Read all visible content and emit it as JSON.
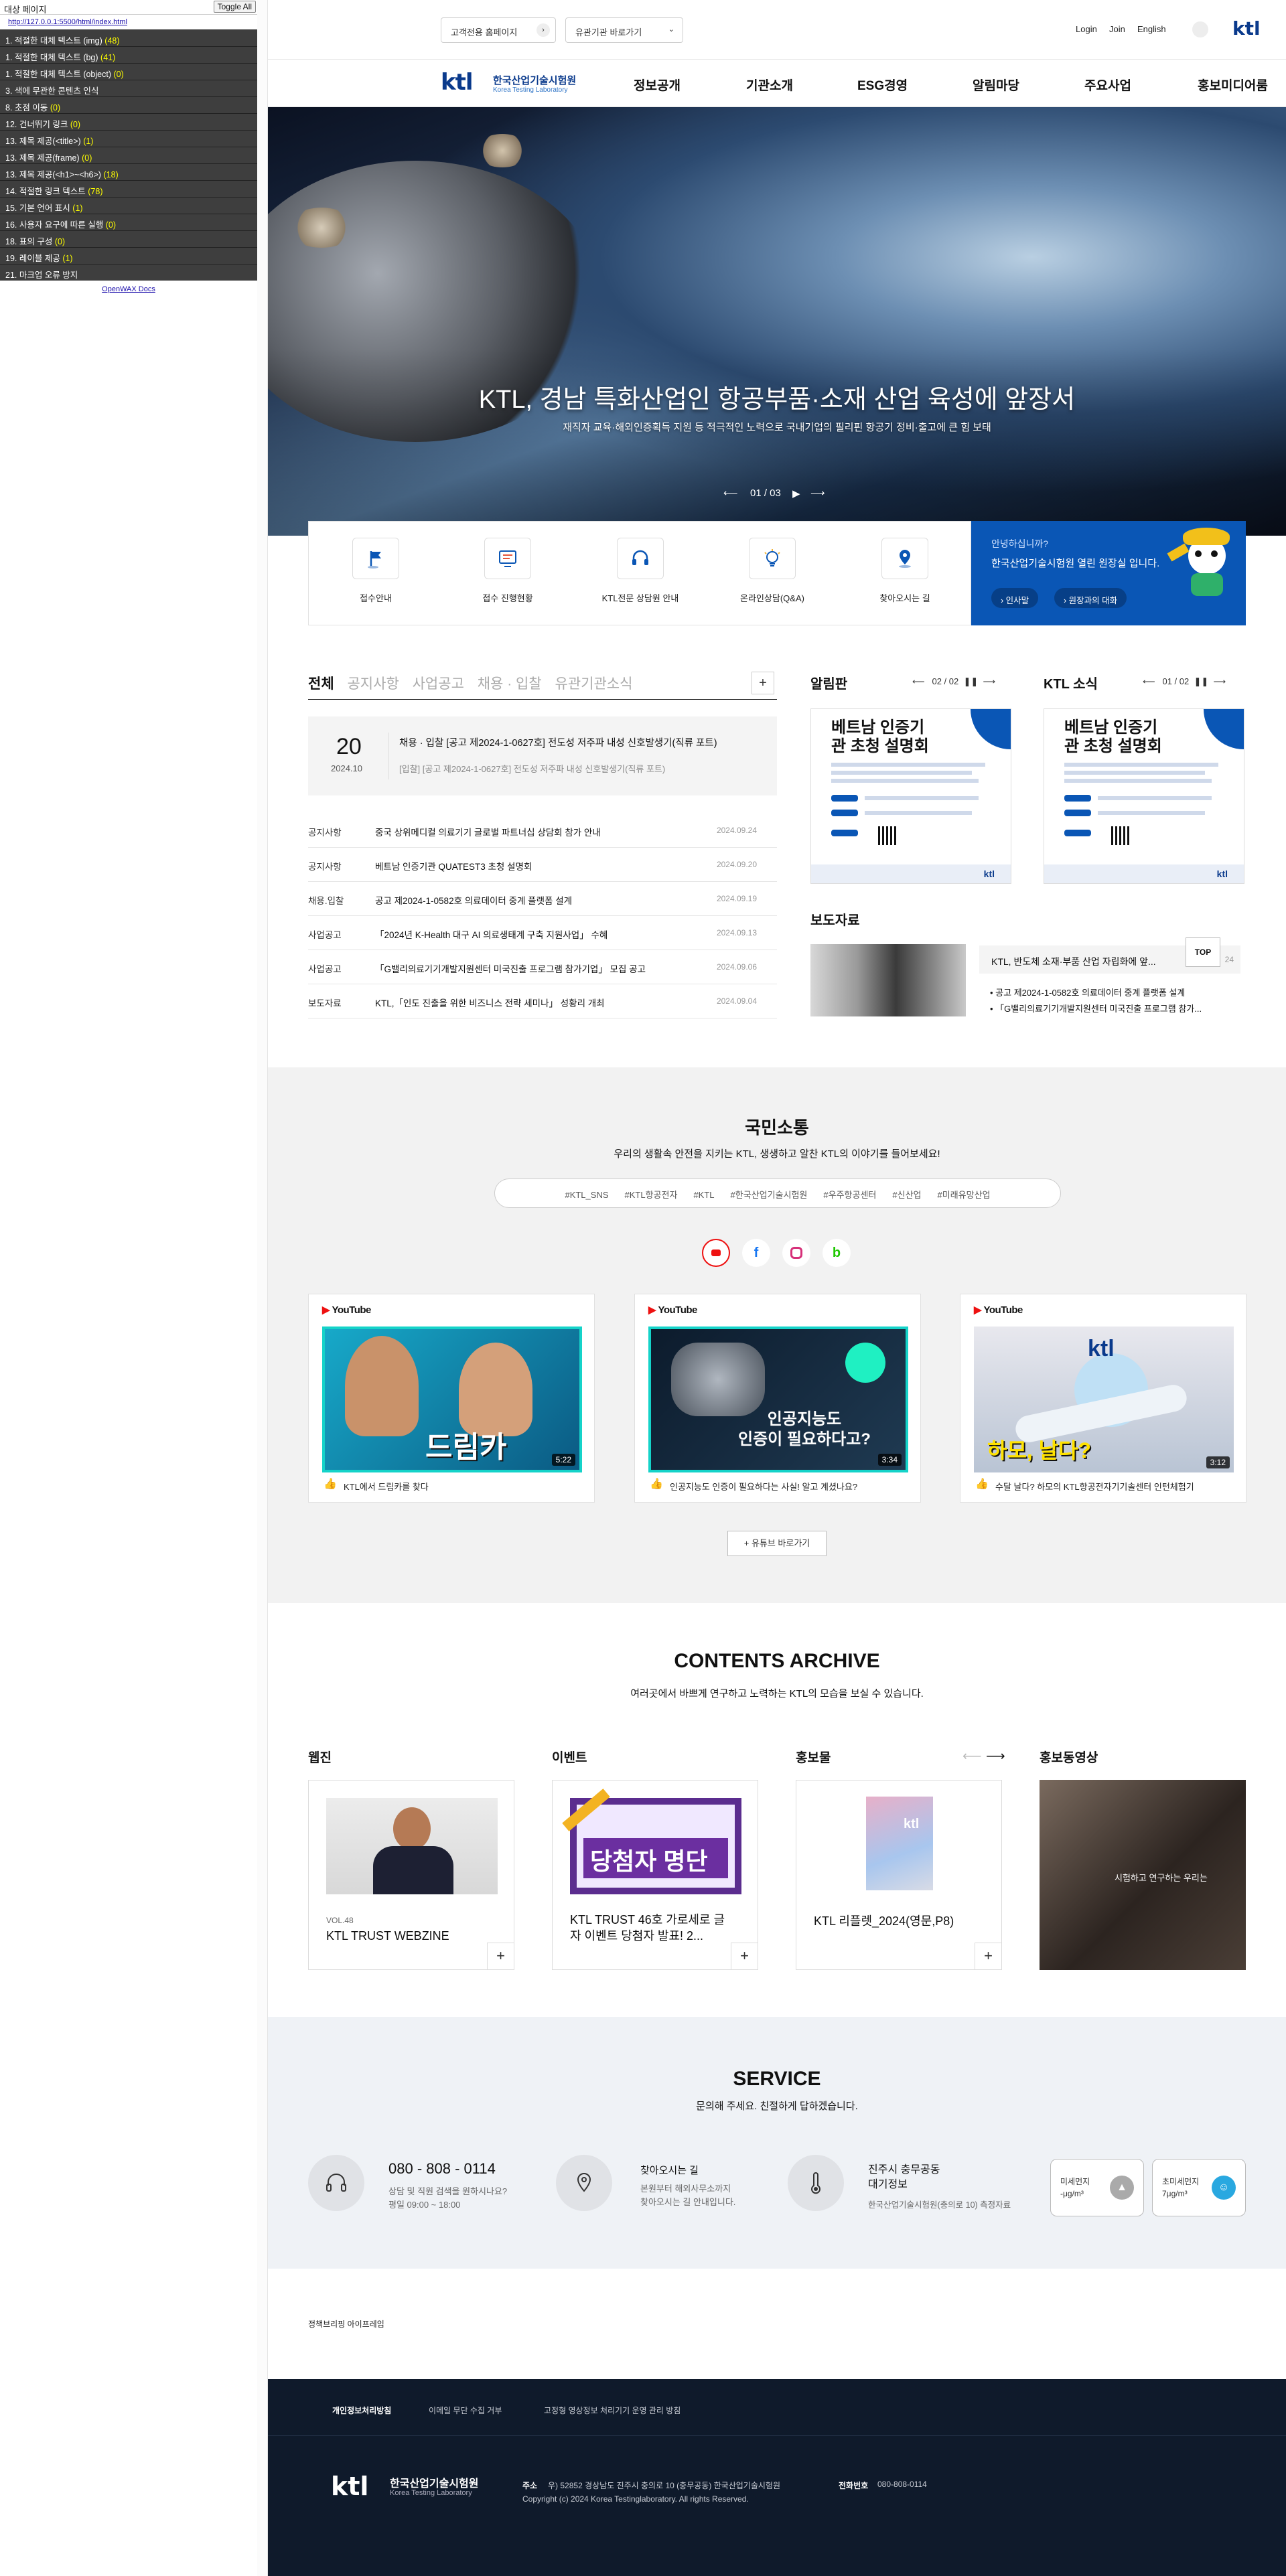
{
  "a11y_panel": {
    "title": "대상 페이지",
    "toggle_label": "Toggle All",
    "url": "http://127.0.0.1:5500/html/index.html",
    "rows": [
      {
        "label": "1. 적절한 대체 텍스트 (img)",
        "count": "(48)"
      },
      {
        "label": "1. 적절한 대체 텍스트 (bg)",
        "count": "(41)"
      },
      {
        "label": "1. 적절한 대체 텍스트 (object)",
        "count": "(0)"
      },
      {
        "label": "3. 색에 무관한 콘텐츠 인식",
        "count": ""
      },
      {
        "label": "8. 초점 이동",
        "count": "(0)"
      },
      {
        "label": "12. 건너뛰기 링크",
        "count": "(0)"
      },
      {
        "label": "13. 제목 제공(<title>)",
        "count": "(1)"
      },
      {
        "label": "13. 제목 제공(frame)",
        "count": "(0)"
      },
      {
        "label": "13. 제목 제공(<h1>~<h6>)",
        "count": "(18)"
      },
      {
        "label": "14. 적절한 링크 텍스트",
        "count": "(78)"
      },
      {
        "label": "15. 기본 언어 표시",
        "count": "(1)"
      },
      {
        "label": "16. 사용자 요구에 따른 실행",
        "count": "(0)"
      },
      {
        "label": "18. 표의 구성",
        "count": "(0)"
      },
      {
        "label": "19. 레이블 제공",
        "count": "(1)"
      },
      {
        "label": "21. 마크업 오류 방지",
        "count": ""
      }
    ],
    "footer_link": "OpenWAX Docs"
  },
  "header": {
    "customer_site": "고객전용 홈페이지",
    "related_sites": "유관기관 바로가기",
    "login": "Login",
    "join": "Join",
    "english": "English",
    "logo_kr": "한국산업기술시험원",
    "logo_en": "Korea Testing Laboratory",
    "logo_mark": "ktl",
    "menu": [
      "정보공개",
      "기관소개",
      "ESG경영",
      "알림마당",
      "주요사업",
      "홍보미디어룸"
    ]
  },
  "hero": {
    "title": "KTL, 경남 특화산업인 항공부품·소재 산업 육성에 앞장서",
    "subtitle": "재직자 교육·해외인증획득 지원 등 적극적인 노력으로 국내기업의 필리핀 항공기 정비·출고에 큰 힘 보태",
    "counter": "01 / 03"
  },
  "quick_menu": [
    {
      "label": "접수안내",
      "icon": "flag-icon"
    },
    {
      "label": "접수 진행현황",
      "icon": "monitor-icon"
    },
    {
      "label": "KTL전문 상담원 안내",
      "icon": "headset-icon"
    },
    {
      "label": "온라인상담(Q&A)",
      "icon": "lightbulb-icon"
    },
    {
      "label": "찾아오시는 길",
      "icon": "map-pin-icon"
    }
  ],
  "guide": {
    "line1": "안녕하십니까?",
    "line2": "한국산업기술시험원 열린 원장실 입니다.",
    "btn1": "인사말",
    "btn2": "원장과의 대화"
  },
  "news": {
    "tabs": [
      "전체",
      "공지사항",
      "사업공고",
      "채용 · 입찰",
      "유관기관소식"
    ],
    "featured": {
      "day": "20",
      "month": "2024.10",
      "title": "채용 · 입찰 [공고 제2024-1-0627호] 전도성 저주파 내성 신호발생기(직류 포트)",
      "desc": "[입찰] [공고 제2024-1-0627호] 전도성 저주파 내성 신호발생기(직류 포트)"
    },
    "rows": [
      {
        "cat": "공지사항",
        "title": "중국 상위메디컬 의료기기 글로벌 파트너십 상담회 참가 안내",
        "date": "2024.09.24"
      },
      {
        "cat": "공지사항",
        "title": "베트남 인증기관 QUATEST3 초청 설명회",
        "date": "2024.09.20"
      },
      {
        "cat": "채용.입찰",
        "title": "공고 제2024-1-0582호 의료데이터 중계 플랫폼 설계",
        "date": "2024.09.19"
      },
      {
        "cat": "사업공고",
        "title": "「2024년 K-Health 대구 AI 의료생태계 구축 지원사업」 수혜",
        "date": "2024.09.13"
      },
      {
        "cat": "사업공고",
        "title": "「G밸리의료기기개발지원센터 미국진출 프로그램 참가기업」 모집 공고",
        "date": "2024.09.06"
      },
      {
        "cat": "보도자료",
        "title": "KTL,「인도 진출을 위한 비즈니스 전략 세미나」 성황리 개최",
        "date": "2024.09.04"
      }
    ]
  },
  "alerts": {
    "title": "알림판",
    "counter": "02 / 02",
    "poster_title": "베트남 인증기관 초청 설명회"
  },
  "ktl_news": {
    "title": "KTL 소식",
    "counter": "01 / 02",
    "poster_title": "베트남 인증기관 초청 설명회"
  },
  "press": {
    "title": "보도자료",
    "headline": "KTL, 반도체 소재·부품 산업 자립화에 앞...",
    "headline_date": "24",
    "items": [
      "공고 제2024-1-0582호 의료데이터 중계 플랫폼 설계",
      "「G밸리의료기기개발지원센터 미국진출 프로그램 참가..."
    ],
    "top_label": "TOP"
  },
  "social": {
    "title": "국민소통",
    "subtitle": "우리의 생활속 안전을 지키는 KTL, 생생하고 알찬 KTL의 이야기를 들어보세요!",
    "hashtags": [
      "#KTL_SNS",
      "#KTL항공전자",
      "#KTL",
      "#한국산업기술시험원",
      "#우주항공센터",
      "#신산업",
      "#미래유망산업"
    ],
    "channels": [
      "youtube-icon",
      "facebook-icon",
      "instagram-icon",
      "blog-icon"
    ],
    "youtube_label": "YouTube",
    "videos": [
      {
        "caption": "KTL에서 드림카를 찾다",
        "duration": "5:22",
        "thumb_text": "드림카"
      },
      {
        "caption": "인공지능도 인증이 필요하다는 사실! 알고 계셨나요?",
        "duration": "3:34",
        "thumb_text": "인공지능도\n인증이 필요하다고?"
      },
      {
        "caption": "수달 날다? 하모의 KTL항공전자기기솔센터 인턴체험기",
        "duration": "3:12",
        "thumb_text": "하모, 날다?"
      }
    ],
    "more_btn": "유튜브 바로가기"
  },
  "archive": {
    "title": "CONTENTS ARCHIVE",
    "subtitle": "여러곳에서 바쁘게 연구하고 노력하는 KTL의 모습을 보실 수 있습니다.",
    "cats": [
      "웹진",
      "이벤트",
      "홍보물",
      "홍보동영상"
    ],
    "cards": [
      {
        "vol": "VOL.48",
        "title": "KTL TRUST WEBZINE"
      },
      {
        "title": "KTL TRUST 46호 가로세로 글자 이벤트 당첨자 발표! 2...",
        "banner": "당첨자 명단"
      },
      {
        "title": "KTL 리플렛_2024(영문,P8)"
      },
      {
        "video_text": "시험하고 연구하는 우리는"
      }
    ]
  },
  "service": {
    "title": "SERVICE",
    "subtitle": "문의해 주세요. 친절하게 답하겠습니다.",
    "phone": "080 - 808 - 0114",
    "phone_desc1": "상담 및 직원 검색을 원하시나요?",
    "phone_desc2": "평일 09:00 ~ 18:00",
    "way": "찾아오시는 길",
    "way_desc1": "본원부터 해외사무소까지",
    "way_desc2": "찾아오시는 길 안내입니다.",
    "air_title1": "진주시 충무공동",
    "air_title2": "대기정보",
    "air_desc": "한국산업기술시험원(충의로 10) 측정자료",
    "dust_label": "미세먼지",
    "dust_value": "-μg/m³",
    "fine_label": "초미세먼지",
    "fine_value": "7μg/m³"
  },
  "policy": "정책브리핑 아이프레임",
  "footer": {
    "links": [
      "개인정보처리방침",
      "이메일 무단 수집 거부",
      "고정형 영상정보 처리기기 운영 관리 방침"
    ],
    "addr_label": "주소",
    "address": "우) 52852 경상남도 진주시 충의로 10 (충무공동) 한국산업기술시험원",
    "tel_label": "전화번호",
    "tel": "080-808-0114",
    "copyright": "Copyright (c) 2024 Korea Testinglaboratory. All rights Reserved."
  }
}
